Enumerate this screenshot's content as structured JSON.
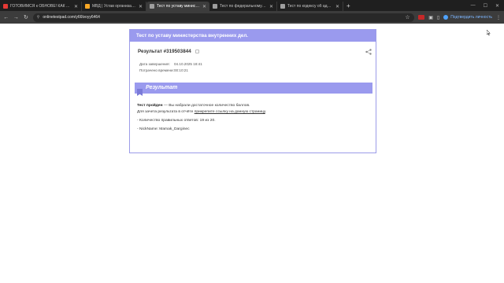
{
  "tabs": [
    {
      "label": "ГОТОВИМСЯ к ОБНОВЕ! КАК ...",
      "favicon_color": "#e53935",
      "active": false
    },
    {
      "label": "МВД | Устав организации | Ка...",
      "favicon_color": "#f9a825",
      "active": false
    },
    {
      "label": "Тест по уставу министерства в...",
      "favicon_color": "#9e9e9e",
      "active": true
    },
    {
      "label": "Тест по федеральному закон...",
      "favicon_color": "#9e9e9e",
      "active": false
    },
    {
      "label": "Тест по кодексу об администр...",
      "favicon_color": "#9e9e9e",
      "active": false
    }
  ],
  "toolbar": {
    "url": "onlinetestpad.com/y66lvoyy6464",
    "profile_label": "Подтвердить личность"
  },
  "card": {
    "header": "Тест по уставу министерства внутренних дел.",
    "result_title": "Результат #319503844",
    "completed_label": "Дата завершения:",
    "completed_value": "04.10.2025 18:41",
    "time_label": "Потрачено времени:",
    "time_value": "00:10:21",
    "section_title": "Результат",
    "passed_bold": "Тест пройден",
    "passed_rest": " — Вы набрали достаточное количество баллов.",
    "instruction_pre": "Для зачета результата в отчёте ",
    "instruction_link": "прикрепите ссылку на данную страницу",
    "instruction_post": ".",
    "correct_answers": "- Количество правильных ответов: 19 из 20.",
    "nickname": "- NickName: Mamak_Darginec"
  },
  "colors": {
    "accent": "#9a9aee",
    "tab_bg": "#1f1f1f",
    "toolbar_bg": "#3c3c3c"
  }
}
